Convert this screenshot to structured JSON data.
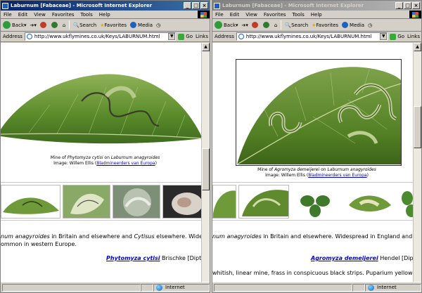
{
  "left": {
    "title": "Laburnum [Fabaceae] - Microsoft Internet Explorer",
    "menu": [
      "File",
      "Edit",
      "View",
      "Favorites",
      "Tools",
      "Help"
    ],
    "toolbar": {
      "back": "Back",
      "search": "Search",
      "favorites": "Favorites",
      "media": "Media"
    },
    "address": {
      "label": "Address",
      "url": "http://www.ukflymines.co.uk/Keys/LABURNUM.html",
      "go": "Go",
      "links": "Links"
    },
    "caption": {
      "line1_a": "Mine of ",
      "line1_species": "Phytomyza cytisi",
      "line1_b": " on ",
      "line1_host": "Laburnum anagyroides",
      "line2_a": "Image: Willem Ellis (",
      "line2_link": "Bladmineerders van Europa",
      "line2_b": ")"
    },
    "body": {
      "line1_a": "num anagyroides",
      "line1_b": " in Britain and elsewhere and ",
      "line1_c": "Cytisus",
      "line1_d": " elsewhere. Widespr",
      "line2": "ommon in western Europe."
    },
    "species": {
      "name": "Phytomyza cytisi",
      "rest": " Brischke [Dipter"
    },
    "status": {
      "zone": "Internet"
    }
  },
  "right": {
    "title": "Laburnum [Fabaceae] - Microsoft Internet Explorer",
    "menu": [
      "File",
      "Edit",
      "View",
      "Favorites",
      "Tools",
      "Help"
    ],
    "toolbar": {
      "back": "Back",
      "search": "Search",
      "favorites": "Favorites",
      "media": "Media"
    },
    "address": {
      "label": "Address",
      "url": "http://www.ukflymines.co.uk/Keys/LABURNUM.html",
      "go": "Go",
      "links": "Links"
    },
    "caption": {
      "line1_a": "Mine of ",
      "line1_species": "Agromyza demeijerei",
      "line1_b": " on ",
      "line1_host": "Laburnum anagyroides",
      "line2_a": "Image: Willem Ellis (",
      "line2_link": "Bladmineerders van Europa",
      "line2_b": ")"
    },
    "body": {
      "line1_a": "num anagyroides",
      "line1_b": " in Britain and elsewhere. Widespread in England and cor"
    },
    "species": {
      "name": "Agromyza demeijerei",
      "rest": " Hendel [Dipter"
    },
    "body2": "whitish, linear mine, frass in conspicuous black strips. Puparium yellow (b",
    "status": {
      "zone": "Internet"
    }
  },
  "colors": {
    "title_active": "#0a246a",
    "title_inactive": "#808080",
    "link": "#0000cc",
    "leaf": "#5e8a2e",
    "chrome": "#d4d0c8"
  }
}
